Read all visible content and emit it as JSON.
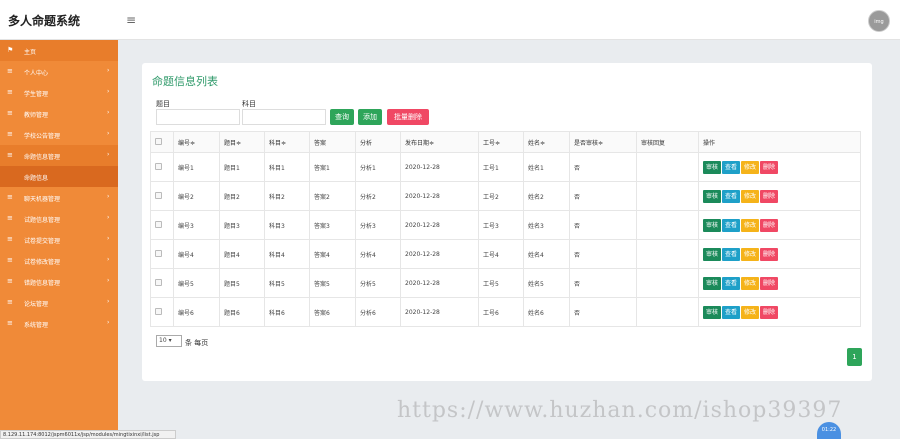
{
  "app": {
    "title": "多人命题系统",
    "menu_icon": "≡",
    "avatar_text": "img"
  },
  "sidebar": {
    "items": [
      {
        "icon": "flag-icon",
        "glyph": "⚑",
        "label": "主页",
        "chevron": ""
      },
      {
        "icon": "list-icon",
        "glyph": "≡",
        "label": "个人中心",
        "chevron": "›"
      },
      {
        "icon": "list-icon",
        "glyph": "≡",
        "label": "学生管理",
        "chevron": "›"
      },
      {
        "icon": "list-icon",
        "glyph": "≡",
        "label": "教师管理",
        "chevron": "›"
      },
      {
        "icon": "list-icon",
        "glyph": "≡",
        "label": "学校公告管理",
        "chevron": "›"
      },
      {
        "icon": "list-icon",
        "glyph": "≡",
        "label": "命题信息管理",
        "chevron": "›"
      },
      {
        "icon": "list-icon",
        "glyph": "≡",
        "label": "聊天机器管理",
        "chevron": "›"
      },
      {
        "icon": "list-icon",
        "glyph": "≡",
        "label": "试题信息管理",
        "chevron": "›"
      },
      {
        "icon": "list-icon",
        "glyph": "≡",
        "label": "试卷提交管理",
        "chevron": "›"
      },
      {
        "icon": "list-icon",
        "glyph": "≡",
        "label": "试卷修改管理",
        "chevron": "›"
      },
      {
        "icon": "list-icon",
        "glyph": "≡",
        "label": "错题信息管理",
        "chevron": "›"
      },
      {
        "icon": "list-icon",
        "glyph": "≡",
        "label": "论坛管理",
        "chevron": "›"
      },
      {
        "icon": "list-icon",
        "glyph": "≡",
        "label": "系统管理",
        "chevron": "›"
      }
    ],
    "sub_item": "命题信息"
  },
  "status_url": "8.129.11.174:8012/jspm6011x/jsp/modules/mingtixinxi/list.jsp",
  "panel": {
    "title": "命题信息列表",
    "search": {
      "label_topic": "题目",
      "label_subject": "科目",
      "btn_query": "查询",
      "btn_add": "添加",
      "btn_batch_delete": "批量删除"
    },
    "columns": [
      "编号≑",
      "题目≑",
      "科目≑",
      "答案",
      "分析",
      "发布日期≑",
      "工号≑",
      "姓名≑",
      "是否审核≑",
      "审核回复",
      "操作"
    ],
    "rows": [
      [
        "编号1",
        "题目1",
        "科目1",
        "答案1",
        "分析1",
        "2020-12-28",
        "工号1",
        "姓名1",
        "否",
        ""
      ],
      [
        "编号2",
        "题目2",
        "科目2",
        "答案2",
        "分析2",
        "2020-12-28",
        "工号2",
        "姓名2",
        "否",
        ""
      ],
      [
        "编号3",
        "题目3",
        "科目3",
        "答案3",
        "分析3",
        "2020-12-28",
        "工号3",
        "姓名3",
        "否",
        ""
      ],
      [
        "编号4",
        "题目4",
        "科目4",
        "答案4",
        "分析4",
        "2020-12-28",
        "工号4",
        "姓名4",
        "否",
        ""
      ],
      [
        "编号5",
        "题目5",
        "科目5",
        "答案5",
        "分析5",
        "2020-12-28",
        "工号5",
        "姓名5",
        "否",
        ""
      ],
      [
        "编号6",
        "题目6",
        "科目6",
        "答案6",
        "分析6",
        "2020-12-28",
        "工号6",
        "姓名6",
        "否",
        ""
      ]
    ],
    "actions": {
      "audit": "审核",
      "view": "查看",
      "edit": "修改",
      "delete": "删除"
    },
    "page_size": "10",
    "page_size_label": "条 每页",
    "current_page": "1"
  },
  "watermark": "https://www.huzhan.com/ishop39397",
  "float_badge": "01:22"
}
